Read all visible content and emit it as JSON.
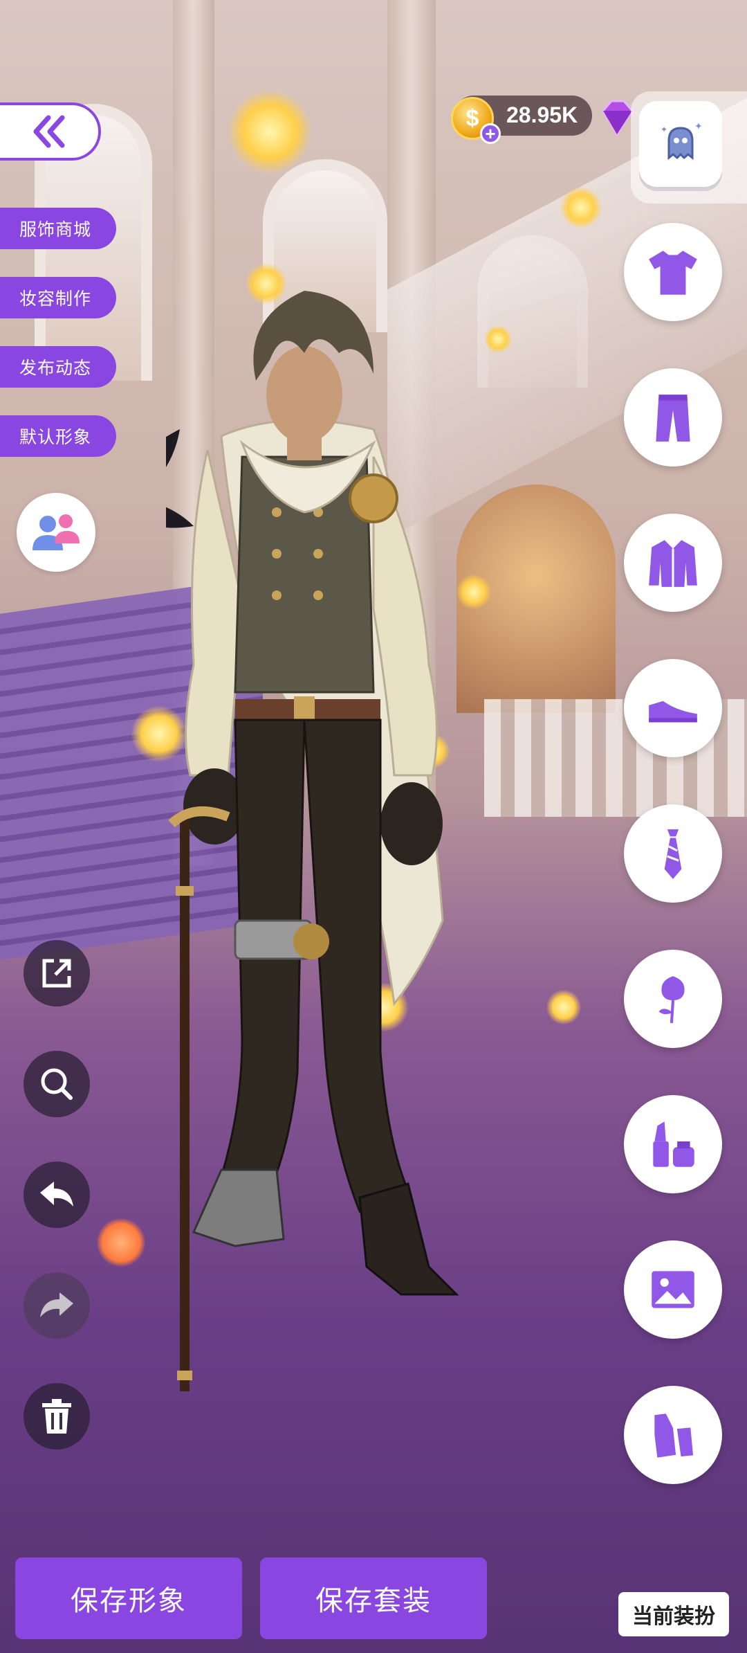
{
  "currency": {
    "coin_amount": "28.95K",
    "coin_plus": "+"
  },
  "side_menu": {
    "items": [
      {
        "label": "服饰商城"
      },
      {
        "label": "妆容制作"
      },
      {
        "label": "发布动态"
      },
      {
        "label": "默认形象"
      }
    ]
  },
  "categories": [
    {
      "icon": "tshirt-icon"
    },
    {
      "icon": "pants-icon"
    },
    {
      "icon": "jacket-icon"
    },
    {
      "icon": "shoe-icon"
    },
    {
      "icon": "tie-icon"
    },
    {
      "icon": "rose-icon"
    },
    {
      "icon": "lipstick-icon"
    },
    {
      "icon": "image-icon"
    },
    {
      "icon": "outfit-set-icon"
    }
  ],
  "tools": [
    {
      "icon": "share-icon"
    },
    {
      "icon": "zoom-icon"
    },
    {
      "icon": "undo-icon"
    },
    {
      "icon": "redo-icon"
    },
    {
      "icon": "trash-icon"
    }
  ],
  "buttons": {
    "save_look": "保存形象",
    "save_outfit": "保存套装",
    "current_outfit": "当前装扮"
  },
  "colors": {
    "accent": "#8a46e0",
    "icon_purple": "#9157e6"
  }
}
